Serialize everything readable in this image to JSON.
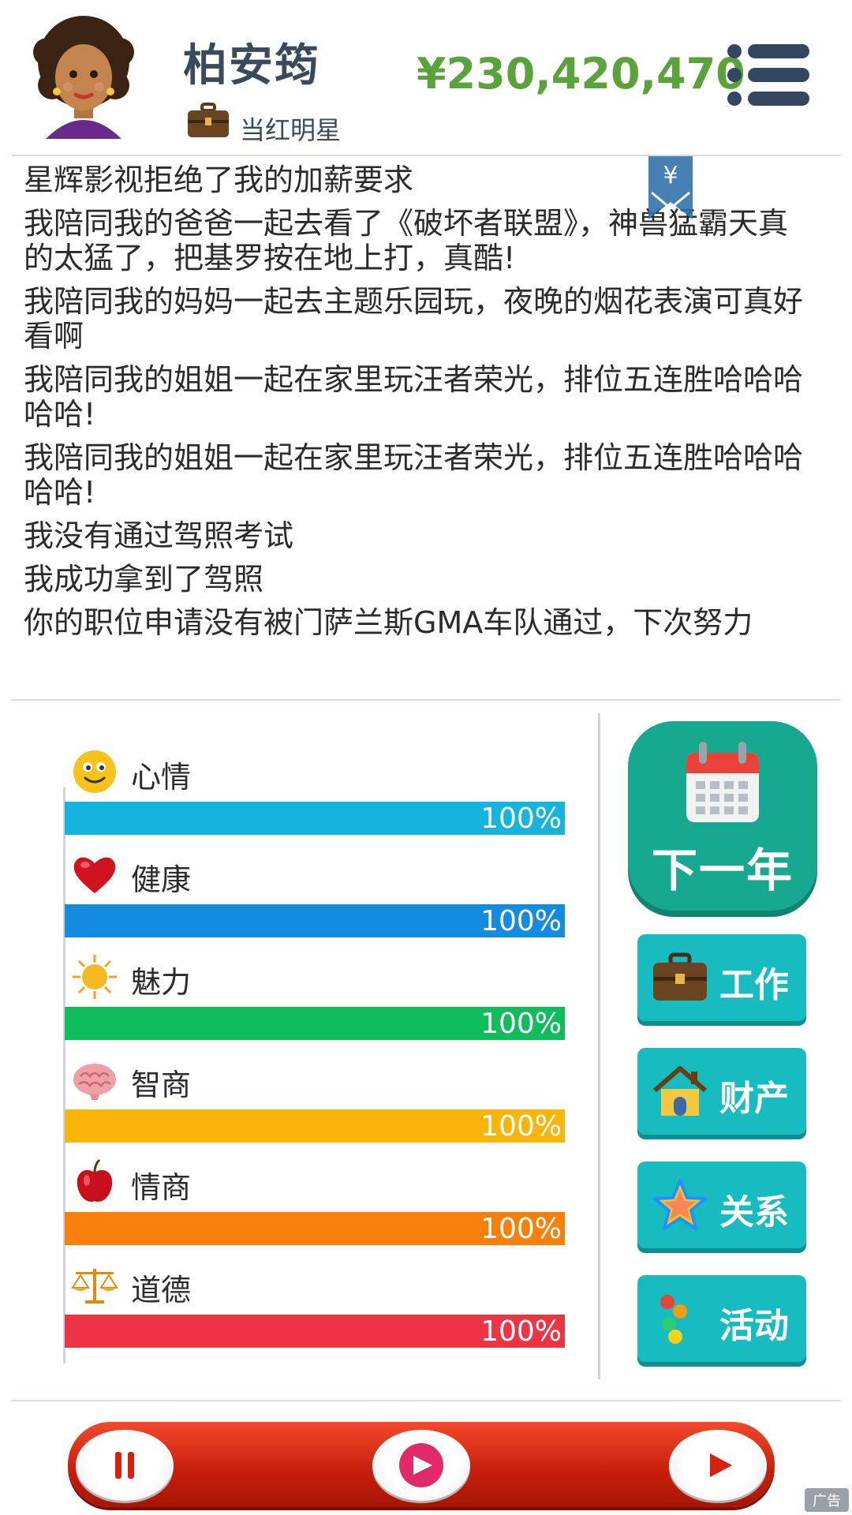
{
  "header": {
    "player_name": "柏安筠",
    "job_title": "当红明星",
    "money": "¥230,420,470"
  },
  "log": {
    "bookmark_symbol": "¥",
    "lines": [
      "星辉影视拒绝了我的加薪要求",
      "我陪同我的爸爸一起去看了《破坏者联盟》，神兽猛霸天真的太猛了，把基罗按在地上打，真酷!",
      "我陪同我的妈妈一起去主题乐园玩，夜晚的烟花表演可真好看啊",
      "我陪同我的姐姐一起在家里玩汪者荣光，排位五连胜哈哈哈哈哈!",
      "我陪同我的姐姐一起在家里玩汪者荣光，排位五连胜哈哈哈哈哈!",
      "我没有通过驾照考试",
      "我成功拿到了驾照",
      "你的职位申请没有被门萨兰斯GMA车队通过，下次努力"
    ]
  },
  "stats": [
    {
      "label": "心情",
      "percent_text": "100%",
      "value": 100,
      "color": "#14b4dc",
      "icon": "smiley-icon"
    },
    {
      "label": "健康",
      "percent_text": "100%",
      "value": 100,
      "color": "#138ce0",
      "icon": "heart-icon"
    },
    {
      "label": "魅力",
      "percent_text": "100%",
      "value": 100,
      "color": "#0fbd5a",
      "icon": "sun-icon"
    },
    {
      "label": "智商",
      "percent_text": "100%",
      "value": 100,
      "color": "#fbb40a",
      "icon": "brain-icon"
    },
    {
      "label": "情商",
      "percent_text": "100%",
      "value": 100,
      "color": "#f8800a",
      "icon": "apple-icon"
    },
    {
      "label": "道德",
      "percent_text": "100%",
      "value": 100,
      "color": "#ee3444",
      "icon": "scales-icon"
    }
  ],
  "actions": {
    "next_year": "下一年",
    "work": "工作",
    "property": "财产",
    "relations": "关系",
    "activity": "活动"
  },
  "footer": {
    "ad_label": "广告"
  }
}
